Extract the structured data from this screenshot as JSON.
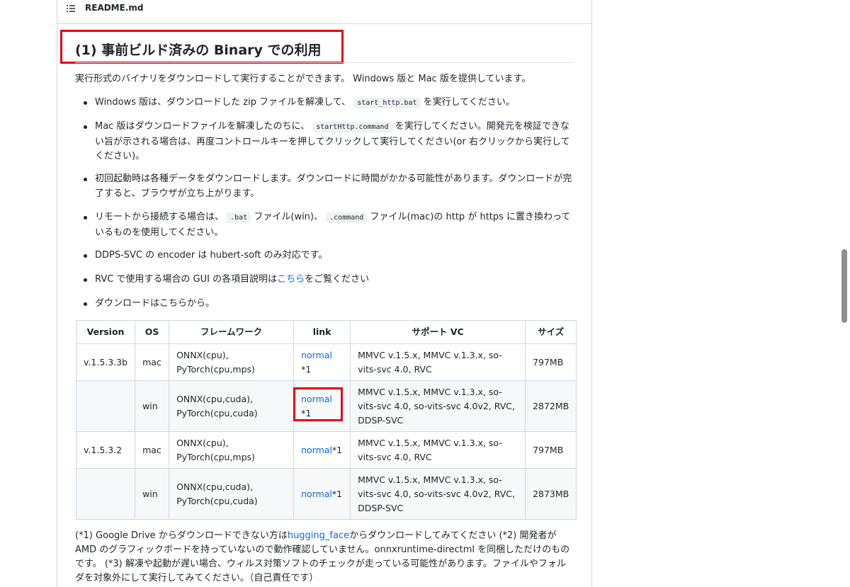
{
  "readme": {
    "filename": "README.md",
    "icon": "list-icon"
  },
  "heading": "(1) 事前ビルド済みの Binary での利用",
  "intro": "実行形式のバイナリをダウンロードして実行することができます。 Windows 版と Mac 版を提供しています。",
  "bullets": [
    {
      "pre": "Windows 版は、ダウンロードした zip ファイルを解凍して、 ",
      "code": "start_http.bat",
      "post": " を実行してください。"
    },
    {
      "pre": "Mac 版はダウンロードファイルを解凍したのちに、 ",
      "code": "startHttp.command",
      "post": " を実行してください。開発元を検証できない旨が示される場合は、再度コントロールキーを押してクリックして実行してください(or 右クリックから実行してください)。"
    },
    {
      "text": "初回起動時は各種データをダウンロードします。ダウンロードに時間がかかる可能性があります。ダウンロードが完了すると、ブラウザが立ち上がります。"
    },
    {
      "pre": "リモートから接続する場合は、 ",
      "code": ".bat",
      "mid": " ファイル(win)、 ",
      "code2": ".command",
      "post": " ファイル(mac)の http が https に置き換わっているものを使用してください。"
    },
    {
      "text": "DDPS-SVC の encoder は hubert-soft のみ対応です。"
    },
    {
      "pre": "RVC で使用する場合の GUI の各項目説明は",
      "link": "こちら",
      "post": "をご覧ください"
    },
    {
      "text": "ダウンロードはこちらから。"
    }
  ],
  "table": {
    "headers": [
      "Version",
      "OS",
      "フレームワーク",
      "link",
      "サポート VC",
      "サイズ"
    ],
    "rows": [
      {
        "version": "v.1.5.3.3b",
        "os": "mac",
        "framework": "ONNX(cpu), PyTorch(cpu,mps)",
        "link_text": "normal",
        "link_note": "*1",
        "vc": "MMVC v.1.5.x, MMVC v.1.3.x, so-vits-svc 4.0, RVC",
        "size": "797MB"
      },
      {
        "version": "",
        "os": "win",
        "framework": "ONNX(cpu,cuda), PyTorch(cpu,cuda)",
        "link_text": "normal",
        "link_note": "*1",
        "vc": "MMVC v.1.5.x, MMVC v.1.3.x, so-vits-svc 4.0, so-vits-svc 4.0v2, RVC, DDSP-SVC",
        "size": "2872MB"
      },
      {
        "version": "v.1.5.3.2",
        "os": "mac",
        "framework": "ONNX(cpu), PyTorch(cpu,mps)",
        "link_text": "normal",
        "link_note": "*1",
        "vc": "MMVC v.1.5.x, MMVC v.1.3.x, so-vits-svc 4.0, RVC",
        "size": "797MB"
      },
      {
        "version": "",
        "os": "win",
        "framework": "ONNX(cpu,cuda), PyTorch(cpu,cuda)",
        "link_text": "normal",
        "link_note": "*1",
        "vc": "MMVC v.1.5.x, MMVC v.1.3.x, so-vits-svc 4.0, so-vits-svc 4.0v2, RVC, DDSP-SVC",
        "size": "2873MB"
      }
    ]
  },
  "footnote": {
    "pre": "(*1) Google Drive からダウンロードできない方は",
    "link": "hugging_face",
    "post": "からダウンロードしてみてください (*2) 開発者が AMD のグラフィックボードを持っていないので動作確認していません。onnxruntime-directml を同梱しただけのものです。 (*3) 解凍や起動が遅い場合、ウィルス対策ソフトのチェックが走っている可能性があります。ファイルやフォルダを対象外にして実行してみてください。（自己責任です）"
  },
  "colors": {
    "highlight": "#e0001b",
    "link": "#0969da"
  }
}
